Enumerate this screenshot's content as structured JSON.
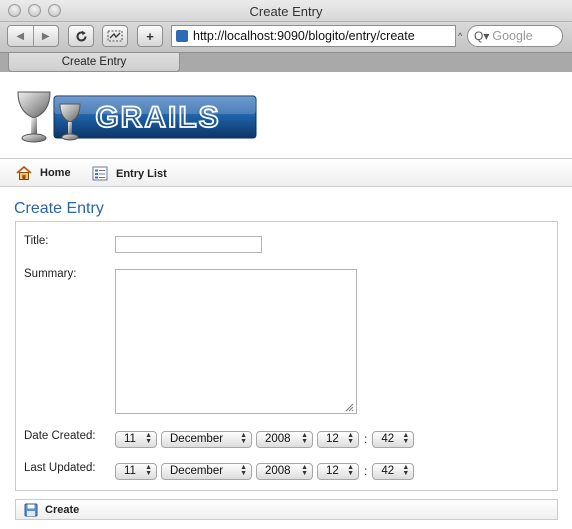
{
  "window": {
    "title": "Create Entry"
  },
  "browser": {
    "url": "http://localhost:9090/blogito/entry/create",
    "search_placeholder": "Google",
    "tab_label": "Create Entry"
  },
  "page": {
    "nav": {
      "home_label": "Home",
      "list_label": "Entry List"
    },
    "heading": "Create Entry",
    "form": {
      "title_label": "Title:",
      "title_value": "",
      "summary_label": "Summary:",
      "summary_value": "",
      "date_created_label": "Date Created:",
      "last_updated_label": "Last Updated:",
      "date_created": {
        "day": "11",
        "month": "December",
        "year": "2008",
        "hour": "12",
        "minute": "42"
      },
      "last_updated": {
        "day": "11",
        "month": "December",
        "year": "2008",
        "hour": "12",
        "minute": "42"
      },
      "time_separator": ":"
    },
    "create_button_label": "Create"
  },
  "colors": {
    "heading": "#2b66a4",
    "logo_blue": "#1d5fa6"
  }
}
